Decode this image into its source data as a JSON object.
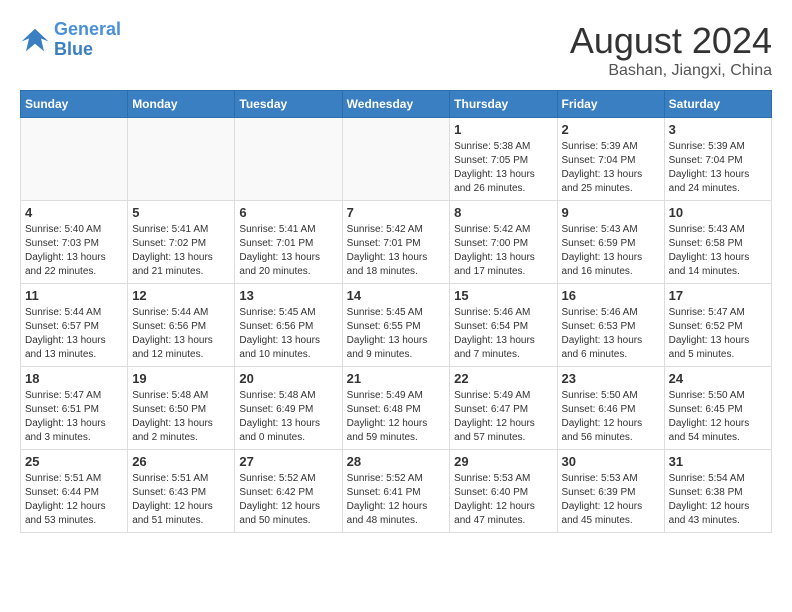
{
  "logo": {
    "line1": "General",
    "line2": "Blue"
  },
  "title": "August 2024",
  "location": "Bashan, Jiangxi, China",
  "days_of_week": [
    "Sunday",
    "Monday",
    "Tuesday",
    "Wednesday",
    "Thursday",
    "Friday",
    "Saturday"
  ],
  "weeks": [
    [
      {
        "day": "",
        "info": ""
      },
      {
        "day": "",
        "info": ""
      },
      {
        "day": "",
        "info": ""
      },
      {
        "day": "",
        "info": ""
      },
      {
        "day": "1",
        "info": "Sunrise: 5:38 AM\nSunset: 7:05 PM\nDaylight: 13 hours\nand 26 minutes."
      },
      {
        "day": "2",
        "info": "Sunrise: 5:39 AM\nSunset: 7:04 PM\nDaylight: 13 hours\nand 25 minutes."
      },
      {
        "day": "3",
        "info": "Sunrise: 5:39 AM\nSunset: 7:04 PM\nDaylight: 13 hours\nand 24 minutes."
      }
    ],
    [
      {
        "day": "4",
        "info": "Sunrise: 5:40 AM\nSunset: 7:03 PM\nDaylight: 13 hours\nand 22 minutes."
      },
      {
        "day": "5",
        "info": "Sunrise: 5:41 AM\nSunset: 7:02 PM\nDaylight: 13 hours\nand 21 minutes."
      },
      {
        "day": "6",
        "info": "Sunrise: 5:41 AM\nSunset: 7:01 PM\nDaylight: 13 hours\nand 20 minutes."
      },
      {
        "day": "7",
        "info": "Sunrise: 5:42 AM\nSunset: 7:01 PM\nDaylight: 13 hours\nand 18 minutes."
      },
      {
        "day": "8",
        "info": "Sunrise: 5:42 AM\nSunset: 7:00 PM\nDaylight: 13 hours\nand 17 minutes."
      },
      {
        "day": "9",
        "info": "Sunrise: 5:43 AM\nSunset: 6:59 PM\nDaylight: 13 hours\nand 16 minutes."
      },
      {
        "day": "10",
        "info": "Sunrise: 5:43 AM\nSunset: 6:58 PM\nDaylight: 13 hours\nand 14 minutes."
      }
    ],
    [
      {
        "day": "11",
        "info": "Sunrise: 5:44 AM\nSunset: 6:57 PM\nDaylight: 13 hours\nand 13 minutes."
      },
      {
        "day": "12",
        "info": "Sunrise: 5:44 AM\nSunset: 6:56 PM\nDaylight: 13 hours\nand 12 minutes."
      },
      {
        "day": "13",
        "info": "Sunrise: 5:45 AM\nSunset: 6:56 PM\nDaylight: 13 hours\nand 10 minutes."
      },
      {
        "day": "14",
        "info": "Sunrise: 5:45 AM\nSunset: 6:55 PM\nDaylight: 13 hours\nand 9 minutes."
      },
      {
        "day": "15",
        "info": "Sunrise: 5:46 AM\nSunset: 6:54 PM\nDaylight: 13 hours\nand 7 minutes."
      },
      {
        "day": "16",
        "info": "Sunrise: 5:46 AM\nSunset: 6:53 PM\nDaylight: 13 hours\nand 6 minutes."
      },
      {
        "day": "17",
        "info": "Sunrise: 5:47 AM\nSunset: 6:52 PM\nDaylight: 13 hours\nand 5 minutes."
      }
    ],
    [
      {
        "day": "18",
        "info": "Sunrise: 5:47 AM\nSunset: 6:51 PM\nDaylight: 13 hours\nand 3 minutes."
      },
      {
        "day": "19",
        "info": "Sunrise: 5:48 AM\nSunset: 6:50 PM\nDaylight: 13 hours\nand 2 minutes."
      },
      {
        "day": "20",
        "info": "Sunrise: 5:48 AM\nSunset: 6:49 PM\nDaylight: 13 hours\nand 0 minutes."
      },
      {
        "day": "21",
        "info": "Sunrise: 5:49 AM\nSunset: 6:48 PM\nDaylight: 12 hours\nand 59 minutes."
      },
      {
        "day": "22",
        "info": "Sunrise: 5:49 AM\nSunset: 6:47 PM\nDaylight: 12 hours\nand 57 minutes."
      },
      {
        "day": "23",
        "info": "Sunrise: 5:50 AM\nSunset: 6:46 PM\nDaylight: 12 hours\nand 56 minutes."
      },
      {
        "day": "24",
        "info": "Sunrise: 5:50 AM\nSunset: 6:45 PM\nDaylight: 12 hours\nand 54 minutes."
      }
    ],
    [
      {
        "day": "25",
        "info": "Sunrise: 5:51 AM\nSunset: 6:44 PM\nDaylight: 12 hours\nand 53 minutes."
      },
      {
        "day": "26",
        "info": "Sunrise: 5:51 AM\nSunset: 6:43 PM\nDaylight: 12 hours\nand 51 minutes."
      },
      {
        "day": "27",
        "info": "Sunrise: 5:52 AM\nSunset: 6:42 PM\nDaylight: 12 hours\nand 50 minutes."
      },
      {
        "day": "28",
        "info": "Sunrise: 5:52 AM\nSunset: 6:41 PM\nDaylight: 12 hours\nand 48 minutes."
      },
      {
        "day": "29",
        "info": "Sunrise: 5:53 AM\nSunset: 6:40 PM\nDaylight: 12 hours\nand 47 minutes."
      },
      {
        "day": "30",
        "info": "Sunrise: 5:53 AM\nSunset: 6:39 PM\nDaylight: 12 hours\nand 45 minutes."
      },
      {
        "day": "31",
        "info": "Sunrise: 5:54 AM\nSunset: 6:38 PM\nDaylight: 12 hours\nand 43 minutes."
      }
    ]
  ]
}
